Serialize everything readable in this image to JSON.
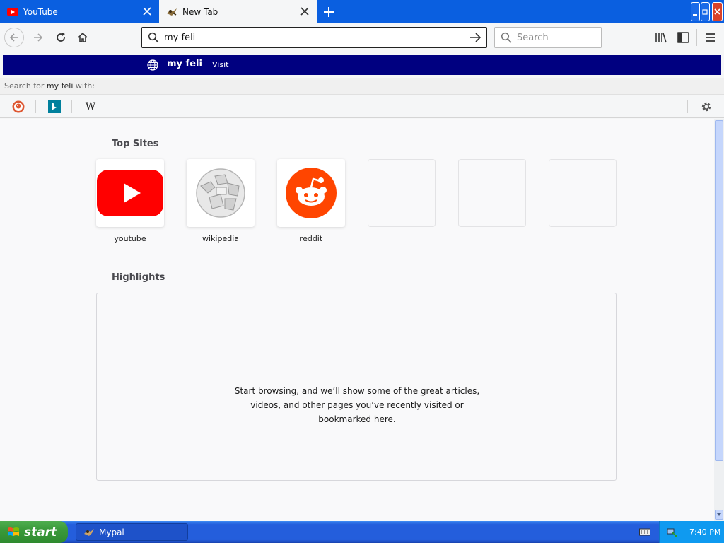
{
  "tabs": [
    {
      "label": "YouTube",
      "active": false
    },
    {
      "label": "New Tab",
      "active": true
    }
  ],
  "navbar": {
    "url_value": "my feli",
    "search_placeholder": "Search"
  },
  "dropdown": {
    "selected_text": "my feli",
    "dash": "–",
    "action": "Visit",
    "search_for_prefix": "Search for ",
    "search_for_term": "my feli",
    "search_for_suffix": " with:",
    "engines": [
      "duckduckgo-icon",
      "bing-icon",
      "wikipedia-icon"
    ],
    "wiki_glyph": "W"
  },
  "content": {
    "top_sites_title": "Top Sites",
    "sites": [
      {
        "label": "youtube"
      },
      {
        "label": "wikipedia"
      },
      {
        "label": "reddit"
      }
    ],
    "highlights_title": "Highlights",
    "highlights_empty": "Start browsing, and we’ll show some of the great articles, videos, and other pages you’ve recently visited or bookmarked here."
  },
  "taskbar": {
    "start_label": "start",
    "task_label": "Mypal",
    "clock": "7:40 PM"
  },
  "colors": {
    "titlebar": "#0a5fe0",
    "selection": "#000080",
    "youtube_red": "#ff0000",
    "reddit_orange": "#ff4500",
    "taskbar": "#245edc",
    "start_green": "#3a9a3a"
  }
}
